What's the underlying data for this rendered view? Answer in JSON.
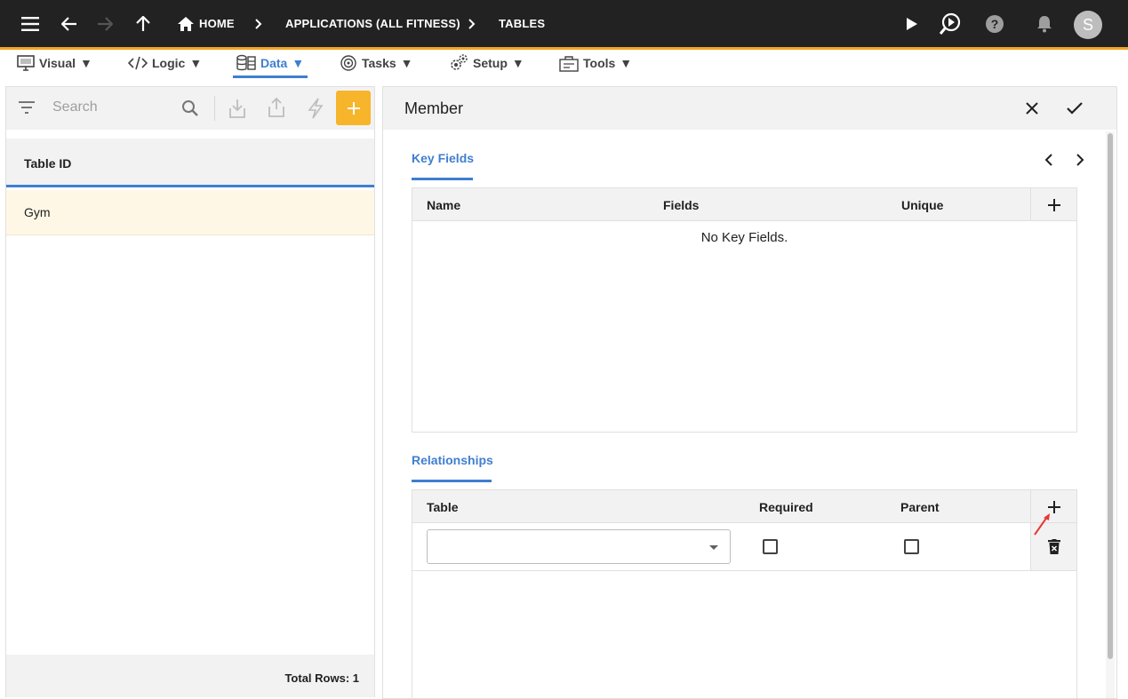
{
  "topbar": {
    "breadcrumbs": [
      "HOME",
      "APPLICATIONS (ALL FITNESS)",
      "TABLES"
    ],
    "avatar_initial": "S"
  },
  "menu": {
    "items": [
      {
        "label": "Visual",
        "icon": "visual-icon"
      },
      {
        "label": "Logic",
        "icon": "code-icon"
      },
      {
        "label": "Data",
        "icon": "data-icon",
        "active": true
      },
      {
        "label": "Tasks",
        "icon": "tasks-icon"
      },
      {
        "label": "Setup",
        "icon": "setup-icon"
      },
      {
        "label": "Tools",
        "icon": "tools-icon"
      }
    ],
    "caret": "▼"
  },
  "left": {
    "search_placeholder": "Search",
    "column_header": "Table ID",
    "rows": [
      "Gym"
    ],
    "total_rows": "Total Rows: 1"
  },
  "right": {
    "title": "Member",
    "key_fields": {
      "title": "Key Fields",
      "columns": [
        "Name",
        "Fields",
        "Unique"
      ],
      "empty_message": "No Key Fields."
    },
    "relationships": {
      "title": "Relationships",
      "columns": [
        "Table",
        "Required",
        "Parent"
      ],
      "rows": [
        {
          "table": "",
          "required": false,
          "parent": false
        }
      ]
    }
  },
  "colors": {
    "accent": "#3f7fd0",
    "topbar": "#222222",
    "topbar_border": "#f5a623",
    "add_button": "#f7b52c",
    "selected_row": "#fff7e6",
    "annotation_arrow": "#e53935"
  }
}
